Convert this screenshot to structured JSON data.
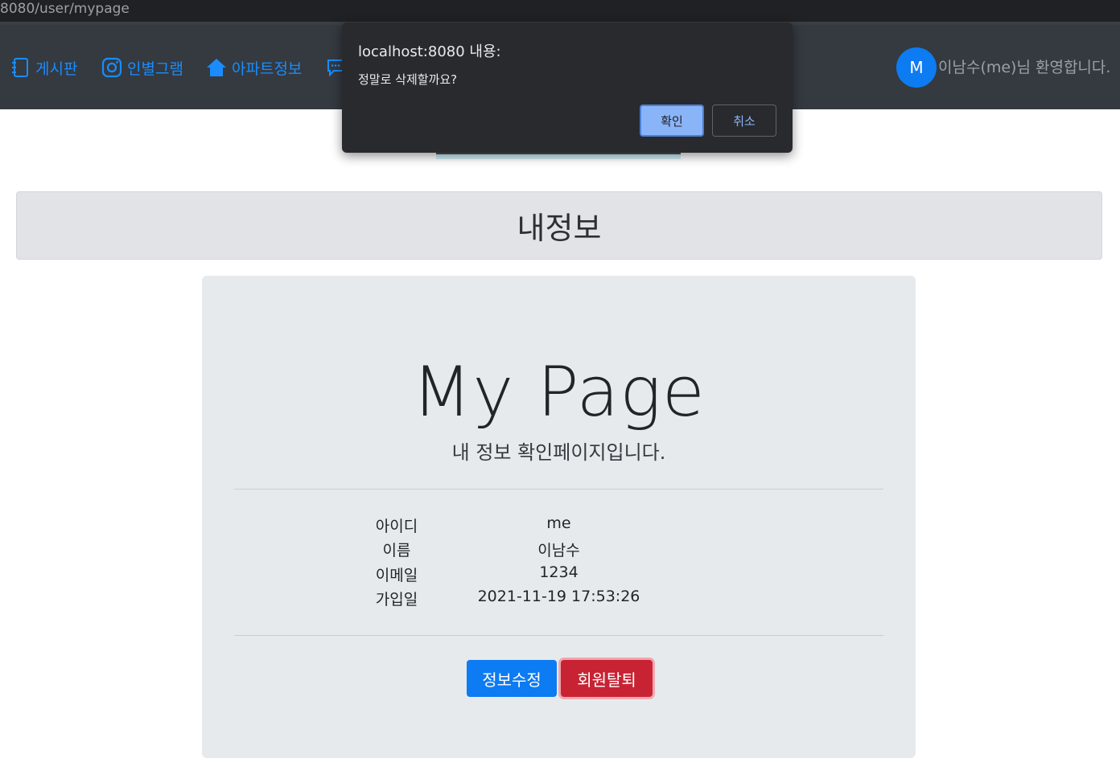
{
  "browser": {
    "url": "8080/user/mypage"
  },
  "navbar": {
    "items": [
      {
        "label": "게시판",
        "icon": "journal-icon"
      },
      {
        "label": "인별그램",
        "icon": "instagram-icon"
      },
      {
        "label": "아파트정보",
        "icon": "house-icon"
      }
    ],
    "avatar_letter": "M",
    "welcome": "이남수(me)님 환영합니다."
  },
  "page": {
    "section_title": "내정보",
    "title": "My Page",
    "subtitle": "내 정보 확인페이지입니다.",
    "info": [
      {
        "label": "아이디",
        "value": "me"
      },
      {
        "label": "이름",
        "value": "이남수"
      },
      {
        "label": "이메일",
        "value": "1234"
      },
      {
        "label": "가입일",
        "value": "2021-11-19 17:53:26"
      }
    ],
    "edit_button": "정보수정",
    "withdraw_button": "회원탈퇴"
  },
  "dialog": {
    "title": "localhost:8080 내용:",
    "message": "정말로 삭제할까요?",
    "ok": "확인",
    "cancel": "취소"
  },
  "colors": {
    "navbar_bg": "#343a40",
    "link": "#1a8cff",
    "primary": "#0d7bf2",
    "danger": "#c82333",
    "dialog_bg": "#292a2d"
  }
}
